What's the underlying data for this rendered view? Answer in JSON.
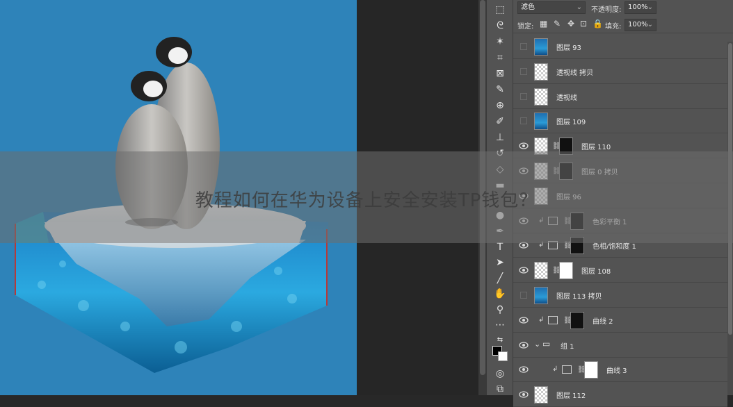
{
  "overlay": {
    "title": "教程如何在华为设备上安全安装TP钱包？"
  },
  "options": {
    "blend_mode": "滤色",
    "opacity_label": "不透明度:",
    "opacity_value": "100%",
    "lock_label": "锁定:",
    "fill_label": "填充:",
    "fill_value": "100%"
  },
  "layers": [
    {
      "name": "图层 93",
      "visible": false,
      "thumb": "ocean"
    },
    {
      "name": "透视线 拷贝",
      "visible": false,
      "thumb": "checker"
    },
    {
      "name": "透视线",
      "visible": false,
      "thumb": "checker"
    },
    {
      "name": "图层 109",
      "visible": false,
      "thumb": "ocean"
    },
    {
      "name": "图层 110",
      "visible": true,
      "thumb": "checker",
      "mask": "black"
    },
    {
      "name": "图层 0 拷贝",
      "visible": true,
      "thumb": "checker",
      "mask": "black"
    },
    {
      "name": "图层 96",
      "visible": true,
      "thumb": "checker"
    },
    {
      "name": "色彩平衡 1",
      "visible": true,
      "thumb": "adjust",
      "mask": "black"
    },
    {
      "name": "色相/饱和度 1",
      "visible": true,
      "thumb": "adjust",
      "mask": "black"
    },
    {
      "name": "图层 108",
      "visible": true,
      "thumb": "checker",
      "mask": "white"
    },
    {
      "name": "图层 113 拷贝",
      "visible": false,
      "thumb": "ocean"
    },
    {
      "name": "曲线 2",
      "visible": true,
      "thumb": "adjust",
      "mask": "black"
    },
    {
      "name": "组 1",
      "visible": true,
      "thumb": "folder"
    },
    {
      "name": "曲线 3",
      "visible": true,
      "thumb": "adjust",
      "mask": "white"
    },
    {
      "name": "图层 112",
      "visible": true,
      "thumb": "checker"
    }
  ],
  "colors": {
    "canvas_bg": "#2e83b9",
    "panel_bg": "#535353",
    "text": "#e8e8e8"
  }
}
